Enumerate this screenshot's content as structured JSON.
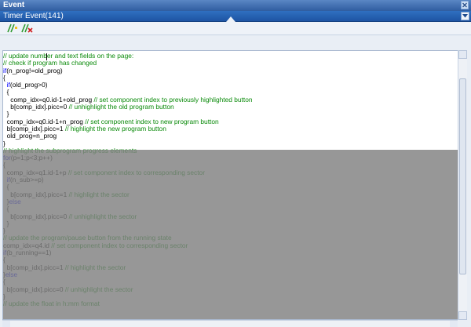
{
  "window": {
    "title": "Event"
  },
  "combo": {
    "selected": "Timer Event(141)"
  },
  "toolbar": {
    "buttons": [
      {
        "name": "comment-lines-icon"
      },
      {
        "name": "uncomment-lines-icon"
      }
    ]
  },
  "code": {
    "lines": [
      [
        {
          "c": "cm",
          "t": "// update number and text fields on the page:"
        }
      ],
      [
        {
          "c": "cm",
          "t": "// check if program has changed"
        }
      ],
      [
        {
          "c": "kw",
          "t": "if"
        },
        {
          "c": "tx",
          "t": "(n_prog!=old_prog)"
        }
      ],
      [
        {
          "c": "tx",
          "t": "{"
        }
      ],
      [
        {
          "c": "tx",
          "t": "  "
        },
        {
          "c": "kw",
          "t": "if"
        },
        {
          "c": "tx",
          "t": "(old_prog>0)"
        }
      ],
      [
        {
          "c": "tx",
          "t": "  {"
        }
      ],
      [
        {
          "c": "tx",
          "t": "    comp_idx=q0.id-1+old_prog "
        },
        {
          "c": "cm",
          "t": "// set component index to previously highlighted button"
        }
      ],
      [
        {
          "c": "tx",
          "t": "    b[comp_idx].picc=0 "
        },
        {
          "c": "cm",
          "t": "// unhighlight the old program button"
        }
      ],
      [
        {
          "c": "tx",
          "t": "  }"
        }
      ],
      [
        {
          "c": "tx",
          "t": "  comp_idx=q0.id-1+n_prog "
        },
        {
          "c": "cm",
          "t": "// set component index to new program button"
        }
      ],
      [
        {
          "c": "tx",
          "t": "  b[comp_idx].picc=1 "
        },
        {
          "c": "cm",
          "t": "// highlight the new program button"
        }
      ],
      [
        {
          "c": "tx",
          "t": "  old_prog=n_prog"
        }
      ],
      [
        {
          "c": "tx",
          "t": "}"
        }
      ],
      [
        {
          "c": "cm",
          "t": "// highlight the subprogram progress elements"
        }
      ],
      [
        {
          "c": "kw",
          "t": "for"
        },
        {
          "c": "tx",
          "t": "(p=1;p<3;p++)"
        }
      ],
      [
        {
          "c": "tx",
          "t": "{"
        }
      ],
      [
        {
          "c": "tx",
          "t": "  comp_idx=q1.id-1+p "
        },
        {
          "c": "cm",
          "t": "// set component index to corresponding sector"
        }
      ],
      [
        {
          "c": "tx",
          "t": "  "
        },
        {
          "c": "kw",
          "t": "if"
        },
        {
          "c": "tx",
          "t": "(n_sub>=p)"
        }
      ],
      [
        {
          "c": "tx",
          "t": "  {"
        }
      ],
      [
        {
          "c": "tx",
          "t": "    b[comp_idx].picc=1 "
        },
        {
          "c": "cm",
          "t": "// highlight the sector"
        }
      ],
      [
        {
          "c": "tx",
          "t": "  }"
        },
        {
          "c": "kw",
          "t": "else"
        }
      ],
      [
        {
          "c": "tx",
          "t": "  {"
        }
      ],
      [
        {
          "c": "tx",
          "t": "    b[comp_idx].picc=0 "
        },
        {
          "c": "cm",
          "t": "// unhighlight the sector"
        }
      ],
      [
        {
          "c": "tx",
          "t": "  }"
        }
      ],
      [
        {
          "c": "tx",
          "t": "}"
        }
      ],
      [
        {
          "c": "cm",
          "t": "// update the program/pause button from the running state"
        }
      ],
      [
        {
          "c": "tx",
          "t": "comp_idx=q4.id "
        },
        {
          "c": "cm",
          "t": "// set component index to corresponding sector"
        }
      ],
      [
        {
          "c": "kw",
          "t": "if"
        },
        {
          "c": "tx",
          "t": "(b_running==1)"
        }
      ],
      [
        {
          "c": "tx",
          "t": "{"
        }
      ],
      [
        {
          "c": "tx",
          "t": "  b[comp_idx].picc=1 "
        },
        {
          "c": "cm",
          "t": "// highlight the sector"
        }
      ],
      [
        {
          "c": "tx",
          "t": "}"
        },
        {
          "c": "kw",
          "t": "else"
        }
      ],
      [
        {
          "c": "tx",
          "t": "{"
        }
      ],
      [
        {
          "c": "tx",
          "t": "  b[comp_idx].picc=0 "
        },
        {
          "c": "cm",
          "t": "// unhighlight the sector"
        }
      ],
      [
        {
          "c": "tx",
          "t": "}"
        }
      ],
      [
        {
          "c": "cm",
          "t": "// update the float in h:mm format"
        }
      ]
    ]
  }
}
